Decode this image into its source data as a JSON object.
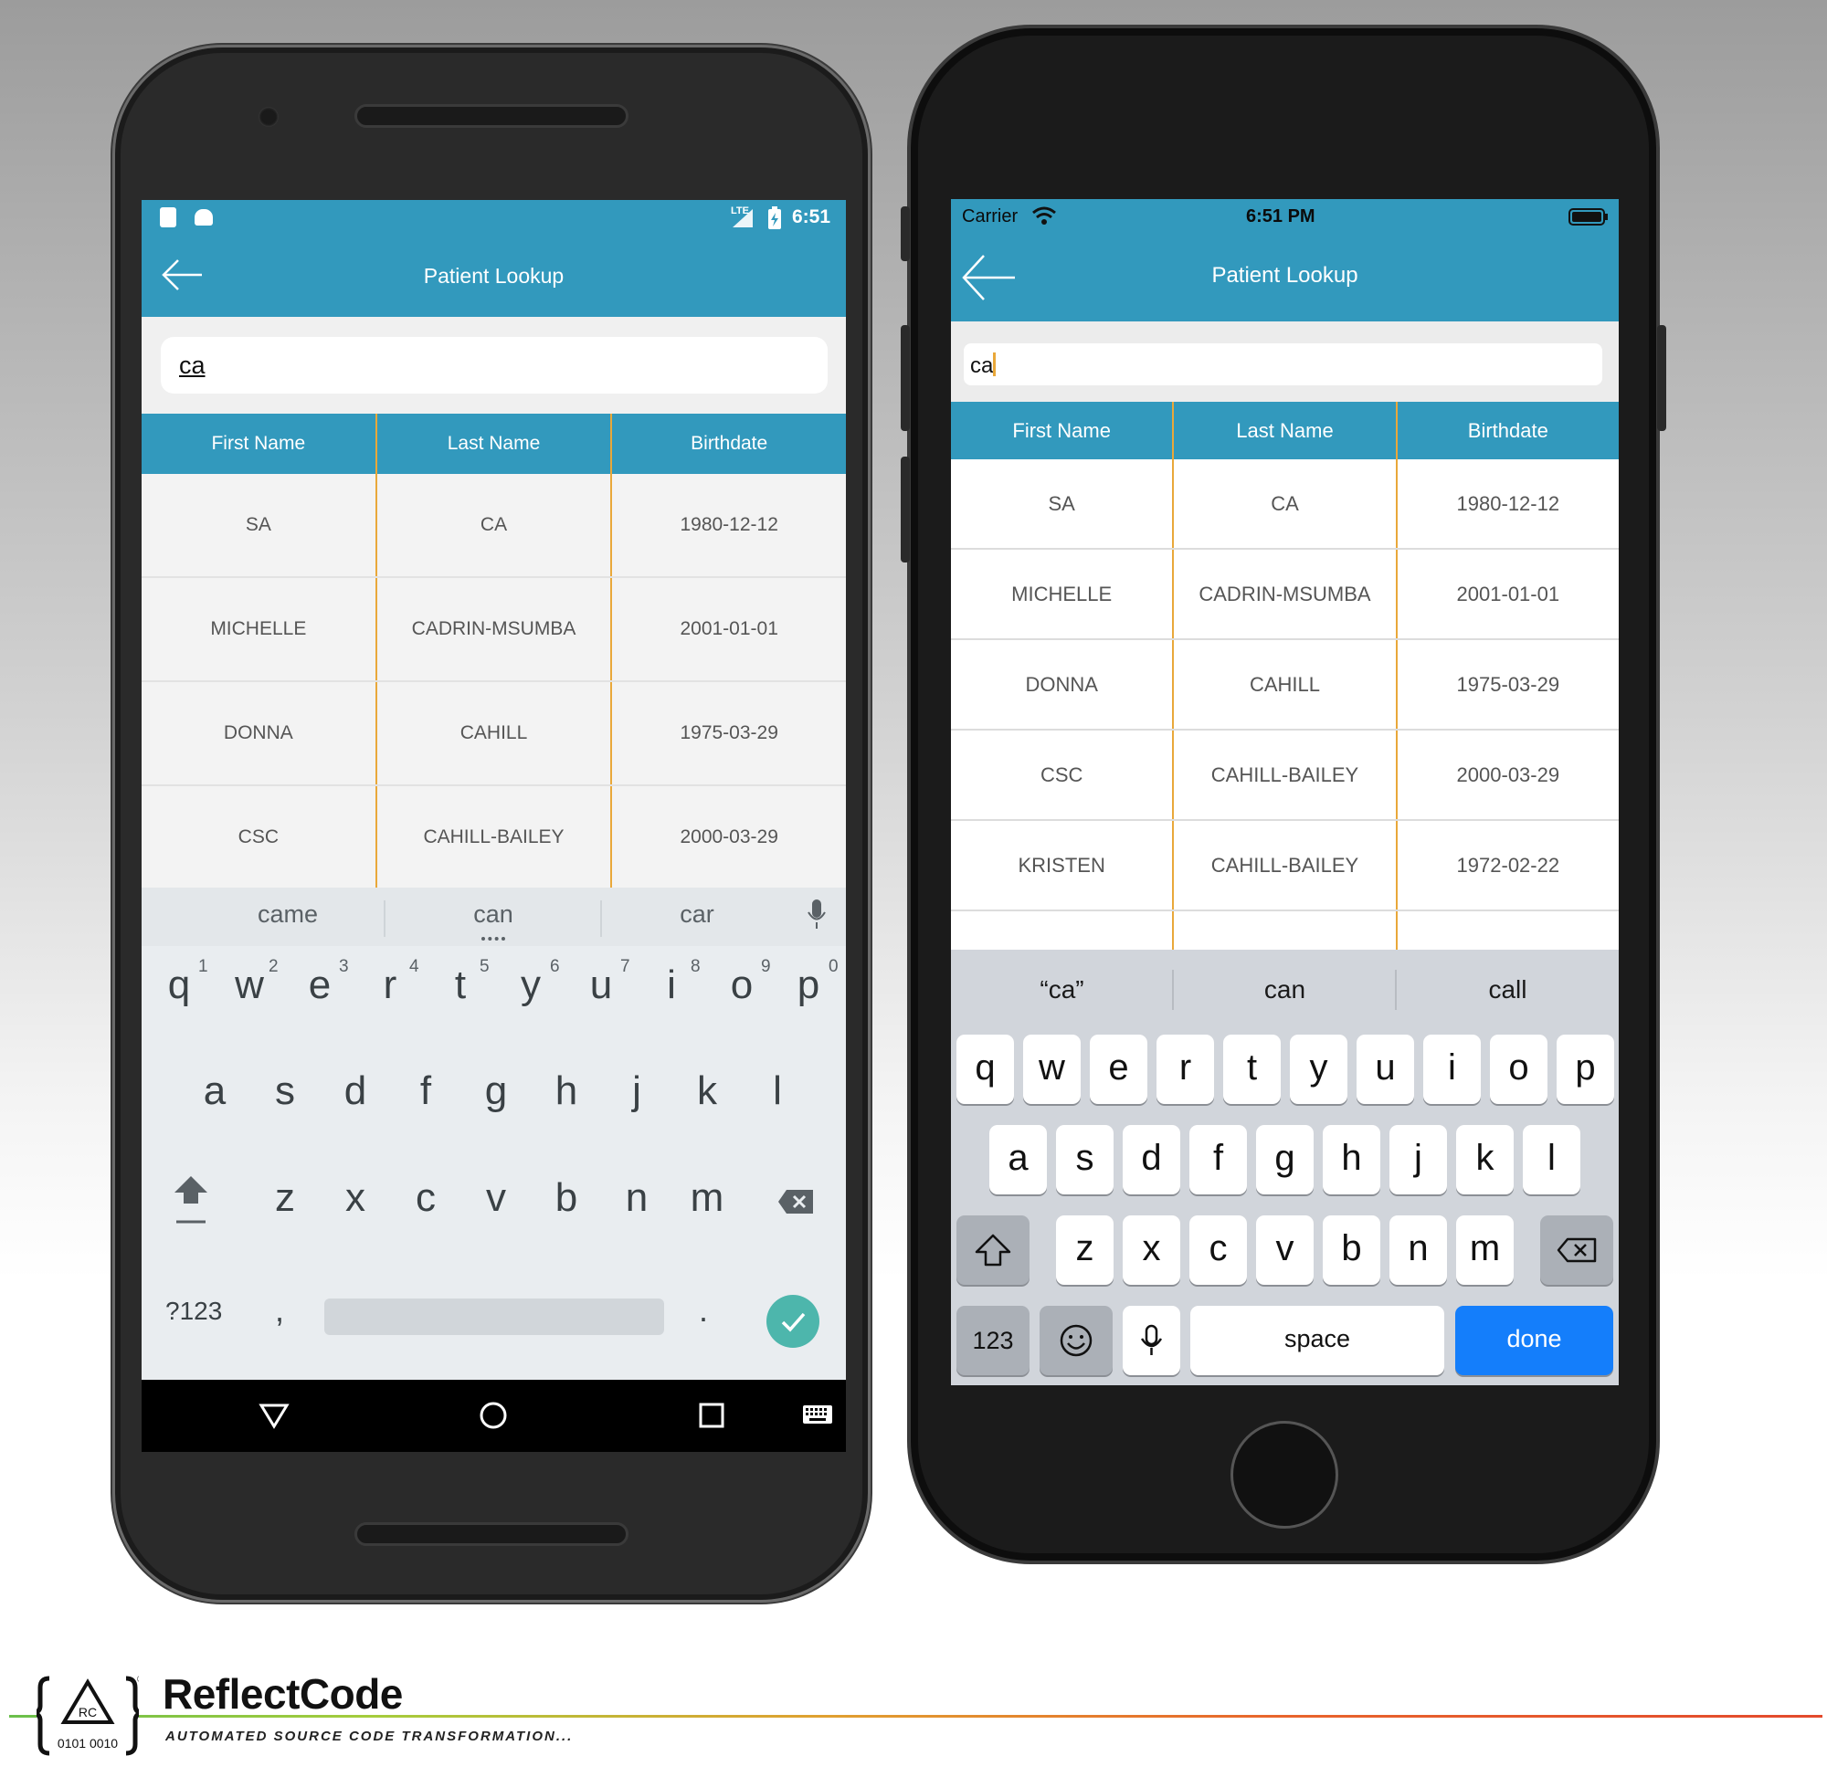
{
  "android": {
    "status": {
      "time": "6:51",
      "network": "LTE"
    },
    "app_bar": {
      "title": "Patient Lookup"
    },
    "search": {
      "value": "ca"
    },
    "table": {
      "headers": [
        "First Name",
        "Last Name",
        "Birthdate"
      ],
      "rows": [
        [
          "SA",
          "CA",
          "1980-12-12"
        ],
        [
          "MICHELLE",
          "CADRIN-MSUMBA",
          "2001-01-01"
        ],
        [
          "DONNA",
          "CAHILL",
          "1975-03-29"
        ],
        [
          "CSC",
          "CAHILL-BAILEY",
          "2000-03-29"
        ]
      ]
    },
    "keyboard": {
      "suggestions": [
        "came",
        "can",
        "car"
      ],
      "numbers": [
        "1",
        "2",
        "3",
        "4",
        "5",
        "6",
        "7",
        "8",
        "9",
        "0"
      ],
      "row1": [
        "q",
        "w",
        "e",
        "r",
        "t",
        "y",
        "u",
        "i",
        "o",
        "p"
      ],
      "row2": [
        "a",
        "s",
        "d",
        "f",
        "g",
        "h",
        "j",
        "k",
        "l"
      ],
      "row3": [
        "z",
        "x",
        "c",
        "v",
        "b",
        "n",
        "m"
      ],
      "symbols_label": "?123",
      "comma": ",",
      "period": "."
    }
  },
  "iphone": {
    "status": {
      "carrier": "Carrier",
      "time": "6:51 PM"
    },
    "app_bar": {
      "title": "Patient Lookup"
    },
    "search": {
      "value": "ca"
    },
    "table": {
      "headers": [
        "First Name",
        "Last Name",
        "Birthdate"
      ],
      "rows": [
        [
          "SA",
          "CA",
          "1980-12-12"
        ],
        [
          "MICHELLE",
          "CADRIN-MSUMBA",
          "2001-01-01"
        ],
        [
          "DONNA",
          "CAHILL",
          "1975-03-29"
        ],
        [
          "CSC",
          "CAHILL-BAILEY",
          "2000-03-29"
        ],
        [
          "KRISTEN",
          "CAHILL-BAILEY",
          "1972-02-22"
        ]
      ]
    },
    "keyboard": {
      "suggestions": [
        "“ca”",
        "can",
        "call"
      ],
      "row1": [
        "q",
        "w",
        "e",
        "r",
        "t",
        "y",
        "u",
        "i",
        "o",
        "p"
      ],
      "row2": [
        "a",
        "s",
        "d",
        "f",
        "g",
        "h",
        "j",
        "k",
        "l"
      ],
      "row3": [
        "z",
        "x",
        "c",
        "v",
        "b",
        "n",
        "m"
      ],
      "numbers_label": "123",
      "space_label": "space",
      "done_label": "done"
    }
  },
  "branding": {
    "name": "ReflectCode",
    "tagline": "AUTOMATED SOURCE CODE TRANSFORMATION...",
    "logo_text_top": "RC",
    "logo_text_bottom": "0101 0010",
    "colors": {
      "accent": "#3299bd",
      "divider": "#e9a83a",
      "ios_done": "#147efb",
      "android_enter": "#4db6ac"
    }
  }
}
